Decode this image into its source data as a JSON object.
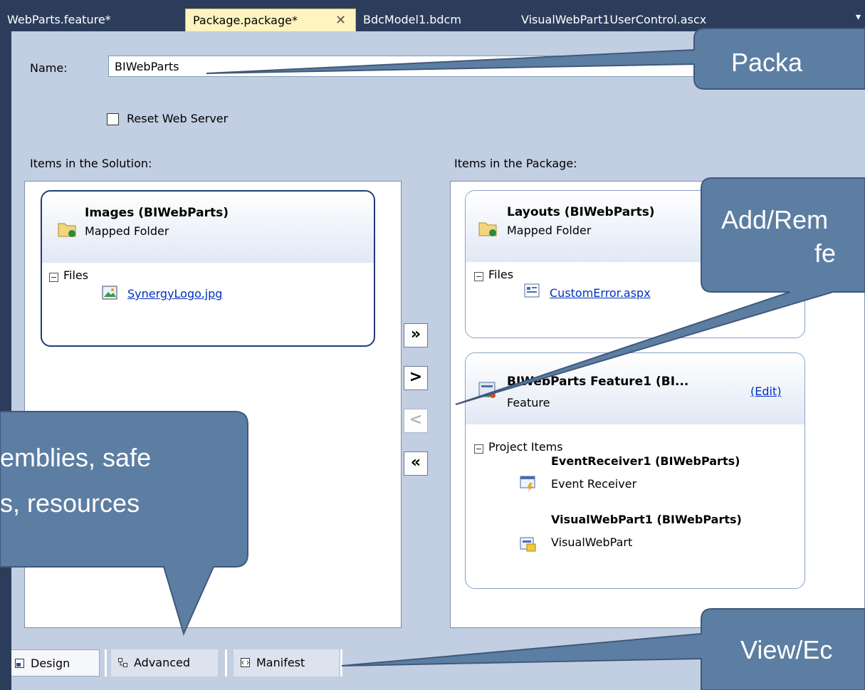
{
  "tabs": [
    {
      "label": "WebParts.feature*"
    },
    {
      "label": "Package.package*"
    },
    {
      "label": "BdcModel1.bdcm"
    },
    {
      "label": "VisualWebPart1UserControl.ascx"
    }
  ],
  "tab_close_glyph": "✕",
  "tab_overflow_glyph": "▾",
  "form": {
    "name_label": "Name:",
    "name_value": "BIWebParts",
    "reset_label": "Reset Web Server",
    "solution_label": "Items in the Solution:",
    "package_label": "Items in the Package:"
  },
  "solution_items": [
    {
      "title": "Images (BIWebParts)",
      "subtitle": "Mapped Folder",
      "group": "Files",
      "file": "SynergyLogo.jpg"
    }
  ],
  "package_items": {
    "layouts": {
      "title": "Layouts (BIWebParts)",
      "subtitle": "Mapped Folder",
      "group": "Files",
      "file": "CustomError.aspx"
    },
    "feature": {
      "title": "BIWebParts Feature1 (BI...",
      "subtitle": "Feature",
      "edit": "(Edit)",
      "group": "Project Items",
      "items": [
        {
          "title": "EventReceiver1 (BIWebParts)",
          "subtitle": "Event Receiver"
        },
        {
          "title": "VisualWebPart1 (BIWebParts)",
          "subtitle": "VisualWebPart"
        }
      ]
    }
  },
  "move_buttons": {
    "add_all": "»",
    "add": ">",
    "remove": "<",
    "remove_all": "«"
  },
  "view_tabs": [
    {
      "label": "Design"
    },
    {
      "label": "Advanced"
    },
    {
      "label": "Manifest"
    }
  ],
  "callouts": {
    "package": "Packa",
    "add_remove_1": "Add/Rem",
    "add_remove_2": "fe",
    "assemblies_1": "emblies, safe",
    "assemblies_2": "s, resources",
    "view_edit": "View/Ec"
  },
  "colors": {
    "callout_fill": "#5d7ea3",
    "tab_strip": "#2c3d5c",
    "active_tab": "#fdf4bf",
    "designer_bg": "#c2cee2"
  }
}
